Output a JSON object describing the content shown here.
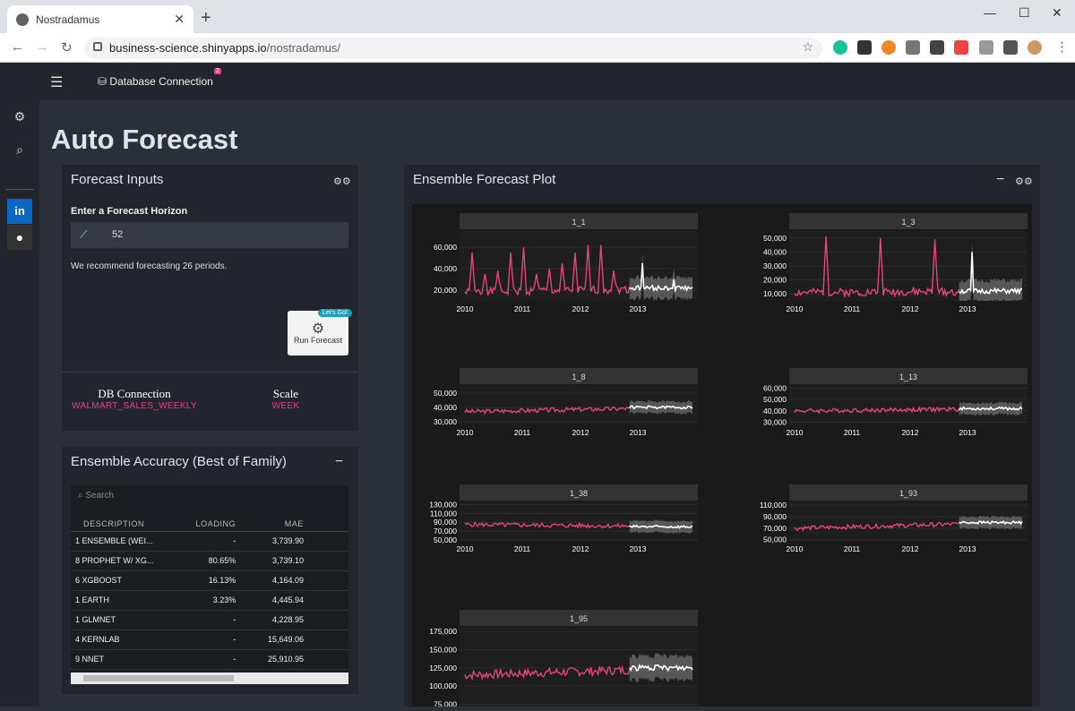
{
  "browser": {
    "tab_title": "Nostradamus",
    "url_host": "business-science.shinyapps.io",
    "url_path": "/nostradamus/"
  },
  "navbar": {
    "menu_icon": "hamburger-icon",
    "db_connection_label": "Database Connection",
    "db_connection_badge": "2"
  },
  "page_title": "Auto Forecast",
  "forecast_inputs": {
    "title": "Forecast Inputs",
    "horizon_label": "Enter a Forecast Horizon",
    "horizon_value": "52",
    "recommendation": "We recommend forecasting 26 periods.",
    "run_button": "Run Forecast",
    "run_badge": "Let's Go!",
    "db_connection_header": "DB Connection",
    "db_connection_value": "WALMART_SALES_WEEKLY",
    "scale_header": "Scale",
    "scale_value": "WEEK"
  },
  "accuracy": {
    "title": "Ensemble Accuracy (Best of Family)",
    "search_placeholder": "Search",
    "columns": [
      "DESCRIPTION",
      "LOADING",
      "MAE"
    ],
    "rows": [
      {
        "id": "1",
        "desc": "ENSEMBLE (WEI...",
        "loading": "-",
        "mae": "3,739.90"
      },
      {
        "id": "8",
        "desc": "PROPHET W/ XG...",
        "loading": "80.65%",
        "mae": "3,739.10"
      },
      {
        "id": "6",
        "desc": "XGBOOST",
        "loading": "16.13%",
        "mae": "4,164.09"
      },
      {
        "id": "1",
        "desc": "EARTH",
        "loading": "3.23%",
        "mae": "4,445.94"
      },
      {
        "id": "1",
        "desc": "GLMNET",
        "loading": "-",
        "mae": "4,228.95"
      },
      {
        "id": "4",
        "desc": "KERNLAB",
        "loading": "-",
        "mae": "15,649.06"
      },
      {
        "id": "9",
        "desc": "NNET",
        "loading": "-",
        "mae": "25,910.95"
      }
    ]
  },
  "plot_panel": {
    "title": "Ensemble Forecast Plot"
  },
  "colors": {
    "actual": "#e5447a",
    "forecast": "#ffffff",
    "ci": "#6b6b6b"
  },
  "chart_data": [
    {
      "type": "line",
      "title": "1_1",
      "x_ticks": [
        "2010",
        "2011",
        "2012",
        "2013"
      ],
      "y_ticks": [
        "20,000",
        "40,000",
        "60,000"
      ],
      "ylim": [
        10000,
        75000
      ],
      "actual_base": 18000,
      "actual_peaks": [
        55000,
        35000,
        38000,
        55000,
        60000,
        35000,
        40000,
        45000,
        55000,
        62000,
        62000,
        38000
      ],
      "forecast_base": 22000,
      "forecast_peaks": [
        45000,
        30000
      ]
    },
    {
      "type": "line",
      "title": "1_3",
      "x_ticks": [
        "2010",
        "2011",
        "2012",
        "2013"
      ],
      "y_ticks": [
        "10,000",
        "20,000",
        "30,000",
        "40,000",
        "50,000"
      ],
      "ylim": [
        5000,
        55000
      ],
      "actual_base": 11000,
      "actual_peaks": [
        51000,
        50000,
        49000
      ],
      "forecast_base": 12000,
      "forecast_peaks": [
        40000
      ]
    },
    {
      "type": "line",
      "title": "1_8",
      "x_ticks": [
        "2010",
        "2011",
        "2012",
        "2013"
      ],
      "y_ticks": [
        "30,000",
        "40,000",
        "50,000"
      ],
      "ylim": [
        28000,
        55000
      ],
      "actual_base": 37000,
      "actual_peaks": [],
      "forecast_base": 40000,
      "forecast_peaks": []
    },
    {
      "type": "line",
      "title": "1_13",
      "x_ticks": [
        "2010",
        "2011",
        "2012",
        "2013"
      ],
      "y_ticks": [
        "30,000",
        "40,000",
        "50,000",
        "60,000"
      ],
      "ylim": [
        28000,
        62000
      ],
      "actual_base": 40000,
      "actual_peaks": [],
      "forecast_base": 42000,
      "forecast_peaks": []
    },
    {
      "type": "line",
      "title": "1_38",
      "x_ticks": [
        "2010",
        "2011",
        "2012",
        "2013"
      ],
      "y_ticks": [
        "50,000",
        "70,000",
        "90,000",
        "110,000",
        "130,000"
      ],
      "ylim": [
        48000,
        135000
      ],
      "actual_base": 85000,
      "actual_peaks": [],
      "forecast_base": 80000,
      "forecast_peaks": []
    },
    {
      "type": "line",
      "title": "1_93",
      "x_ticks": [
        "2010",
        "2011",
        "2012",
        "2013"
      ],
      "y_ticks": [
        "50,000",
        "70,000",
        "90,000",
        "110,000"
      ],
      "ylim": [
        48000,
        115000
      ],
      "actual_base": 70000,
      "actual_peaks": [],
      "forecast_base": 80000,
      "forecast_peaks": []
    },
    {
      "type": "line",
      "title": "1_95",
      "x_ticks": [
        "2010",
        "2011",
        "2012",
        "2013"
      ],
      "y_ticks": [
        "75,000",
        "100,000",
        "125,000",
        "150,000",
        "175,000"
      ],
      "ylim": [
        72000,
        180000
      ],
      "actual_base": 115000,
      "actual_peaks": [],
      "forecast_base": 125000,
      "forecast_peaks": []
    }
  ]
}
